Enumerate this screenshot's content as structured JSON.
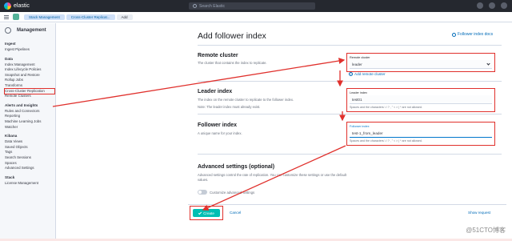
{
  "header": {
    "logo_text": "elastic",
    "search_placeholder": "Search Elastic"
  },
  "breadcrumbs": [
    {
      "label": "Stack Management"
    },
    {
      "label": "Cross-Cluster Replicat..."
    },
    {
      "label": "Add"
    }
  ],
  "sidebar": {
    "title": "Management",
    "groups": [
      {
        "title": "Ingest",
        "items": [
          "Ingest Pipelines"
        ]
      },
      {
        "title": "Data",
        "items": [
          "Index Management",
          "Index Lifecycle Policies",
          "Snapshot and Restore",
          "Rollup Jobs",
          "Transforms",
          "Cross-Cluster Replication",
          "Remote Clusters"
        ]
      },
      {
        "title": "Alerts and Insights",
        "items": [
          "Rules and Connectors",
          "Reporting",
          "Machine Learning Jobs",
          "Watcher"
        ]
      },
      {
        "title": "Kibana",
        "items": [
          "Data Views",
          "Saved Objects",
          "Tags",
          "Search Sessions",
          "Spaces",
          "Advanced Settings"
        ]
      },
      {
        "title": "Stack",
        "items": [
          "License Management"
        ]
      }
    ]
  },
  "main": {
    "title": "Add follower index",
    "docs_link": "Follower index docs",
    "remote_cluster": {
      "title": "Remote cluster",
      "description": "The cluster that contains the index to replicate.",
      "field_label": "Remote cluster",
      "value": "leader",
      "add_link": "Add remote cluster"
    },
    "leader_index": {
      "title": "Leader index",
      "description": "The index on the remote cluster to replicate to the follower index.",
      "note": "Note: The leader index must already exist.",
      "field_label": "Leader index",
      "value": "test01",
      "help": "Spaces and the characters \\ / ? , \" < > | * are not allowed."
    },
    "follower_index": {
      "title": "Follower index",
      "description": "A unique name for your index.",
      "field_label": "Follower index",
      "value": "test-1_from_leader",
      "help": "Spaces and the characters \\ / ? , \" < > | * are not allowed."
    },
    "advanced": {
      "title": "Advanced settings (optional)",
      "description": "Advanced settings control the rate of replication. You can customize these settings or use the default values.",
      "toggle_label": "Customize advanced settings"
    },
    "create_label": "Create",
    "cancel_label": "Cancel",
    "show_request_label": "Show request"
  },
  "watermark": "@51CTO博客",
  "colors": {
    "annotation_red": "#e0302c",
    "accent_teal": "#00bfb3",
    "link_blue": "#006bb8"
  }
}
